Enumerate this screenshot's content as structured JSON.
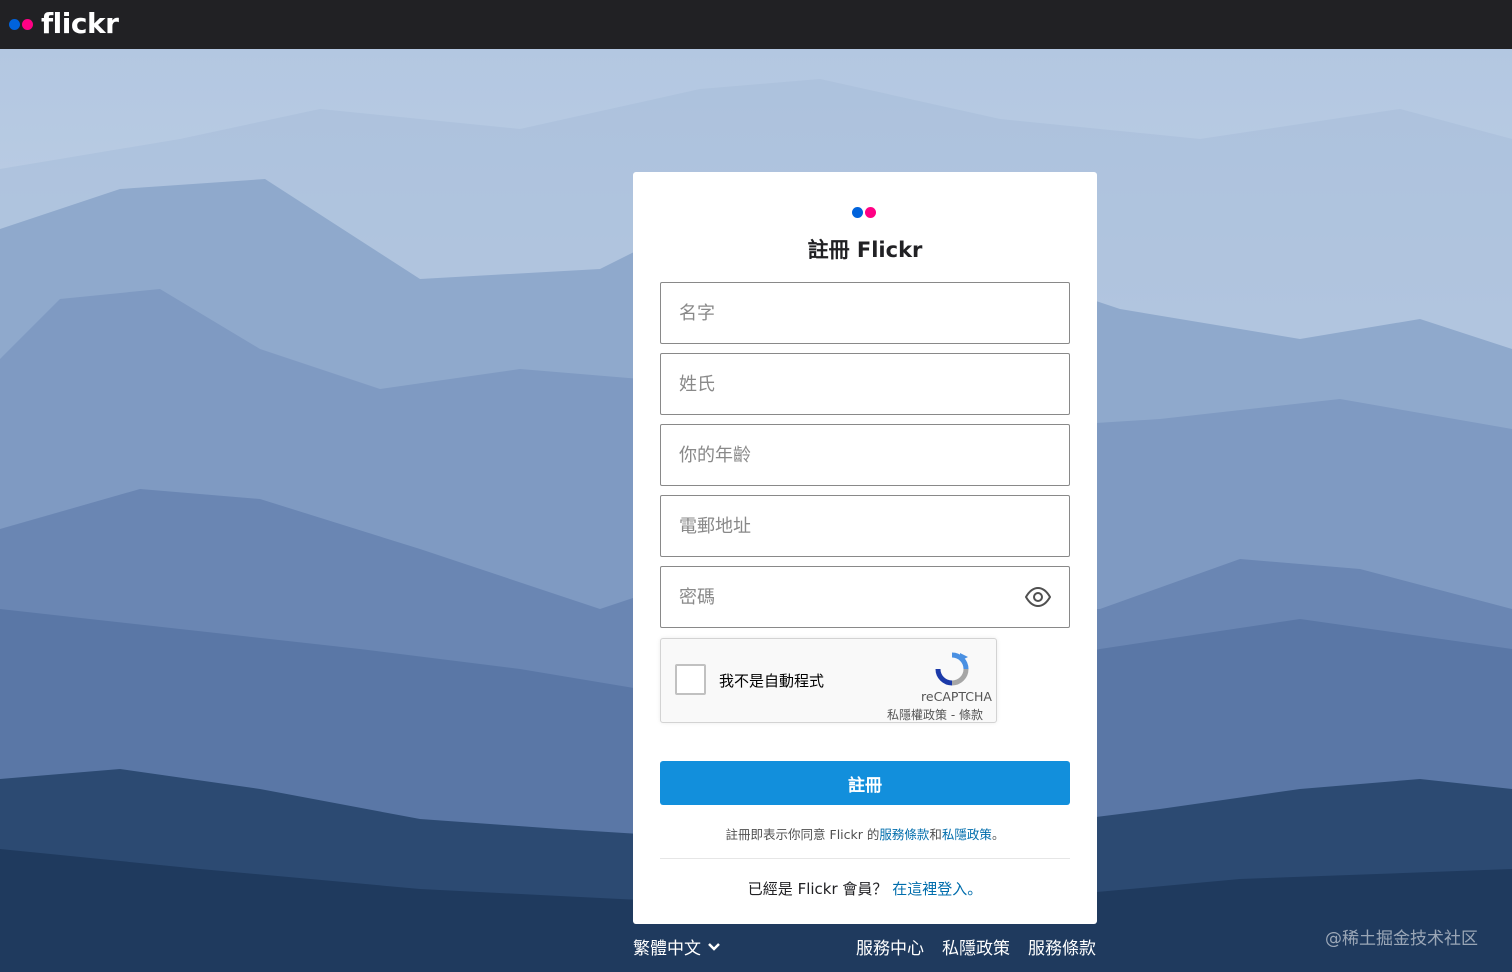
{
  "header": {
    "logo_text": "flickr"
  },
  "colors": {
    "flickr_blue": "#0063dc",
    "flickr_pink": "#ff0084",
    "primary_button": "#128fdc",
    "link": "#006dac"
  },
  "form": {
    "title": "註冊 Flickr",
    "first_name_placeholder": "名字",
    "last_name_placeholder": "姓氏",
    "age_placeholder": "你的年齡",
    "email_placeholder": "電郵地址",
    "password_placeholder": "密碼",
    "show_password_icon": "eye-icon",
    "submit_label": "註冊"
  },
  "captcha": {
    "label": "我不是自動程式",
    "brand": "reCAPTCHA",
    "privacy": "私隱權政策",
    "separator": " - ",
    "terms": "條款"
  },
  "terms": {
    "prefix": "註冊即表示你同意 Flickr 的",
    "tos_link": "服務條款",
    "and": "和",
    "privacy_link": "私隱政策",
    "suffix": "。"
  },
  "signin": {
    "prefix": "已經是 Flickr 會員？",
    "link": "在這裡登入。"
  },
  "footer": {
    "language": "繁體中文",
    "links": [
      "服務中心",
      "私隱政策",
      "服務條款"
    ]
  },
  "watermark": "@稀土掘金技术社区"
}
